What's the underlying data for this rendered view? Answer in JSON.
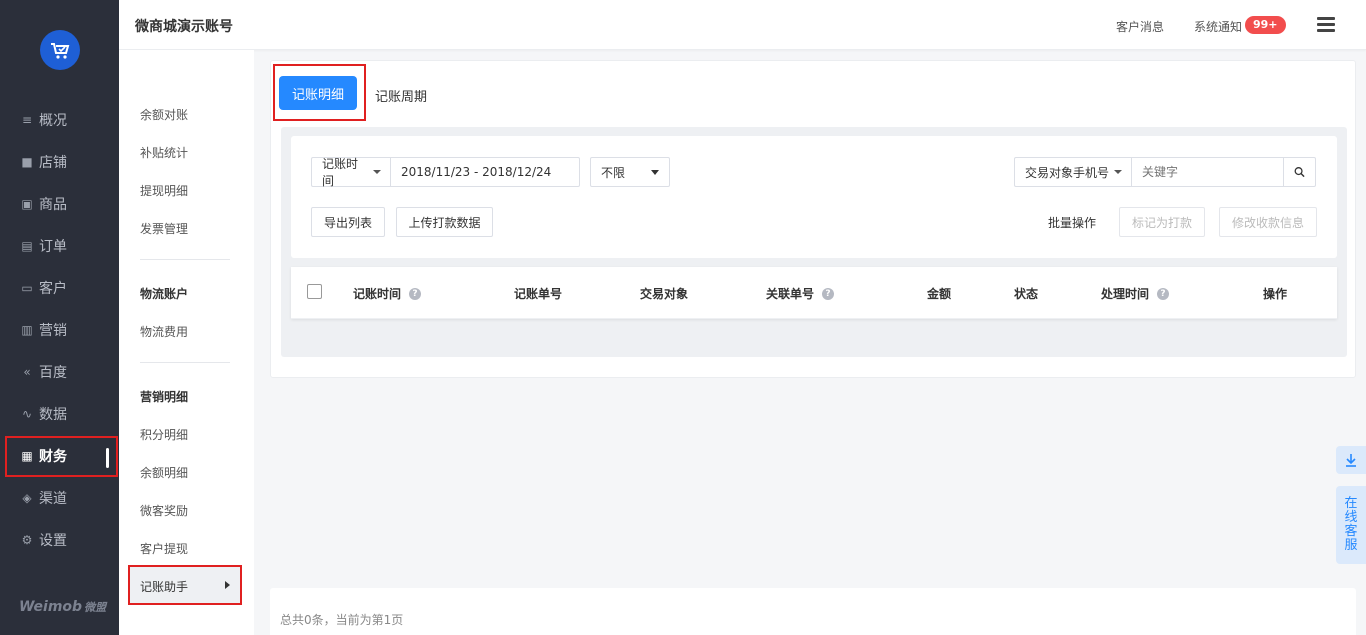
{
  "nav": {
    "items": [
      {
        "label": "概况",
        "icon": "overview-icon"
      },
      {
        "label": "店铺",
        "icon": "store-icon"
      },
      {
        "label": "商品",
        "icon": "goods-icon"
      },
      {
        "label": "订单",
        "icon": "order-icon"
      },
      {
        "label": "客户",
        "icon": "customer-icon"
      },
      {
        "label": "营销",
        "icon": "marketing-icon"
      },
      {
        "label": "百度",
        "icon": "baidu-icon"
      },
      {
        "label": "数据",
        "icon": "data-icon"
      },
      {
        "label": "财务",
        "icon": "finance-icon",
        "active": true
      },
      {
        "label": "渠道",
        "icon": "channel-icon"
      },
      {
        "label": "设置",
        "icon": "settings-icon"
      }
    ],
    "brand": "Weimob",
    "brand_cn": "微盟"
  },
  "header": {
    "title": "微商城演示账号",
    "customer_msg": "客户消息",
    "system_notice": "系统通知",
    "notice_badge": "99+"
  },
  "subnav": {
    "items": {
      "balance_check": "余额对账",
      "subsidy_stats": "补贴统计",
      "withdraw_detail": "提现明细",
      "invoice_mgmt": "发票管理",
      "logistics_head": "物流账户",
      "logistics_fee": "物流费用",
      "marketing_head": "营销明细",
      "points_detail": "积分明细",
      "balance_detail": "余额明细",
      "weike_reward": "微客奖励",
      "customer_withdraw": "客户提现",
      "bookkeeping_assistant": "记账助手"
    }
  },
  "main": {
    "tabs": {
      "active": "记账明细",
      "other": "记账周期"
    },
    "filters": {
      "time_type": "记账时间",
      "date_range": "2018/11/23 - 2018/12/24",
      "status_select": "不限",
      "search_field": "交易对象手机号",
      "search_placeholder": "关键字"
    },
    "actions": {
      "export": "导出列表",
      "upload": "上传打款数据",
      "batch_label": "批量操作",
      "mark_paid": "标记为打款",
      "edit_payee": "修改收款信息"
    },
    "table_headers": {
      "time": "记账时间",
      "number": "记账单号",
      "party": "交易对象",
      "related": "关联单号",
      "amount": "金额",
      "status": "状态",
      "process_time": "处理时间",
      "ops": "操作"
    }
  },
  "footer": {
    "summary": "总共0条，当前为第1页"
  },
  "floating": {
    "online_service": [
      "在",
      "线",
      "客",
      "服"
    ]
  },
  "colors": {
    "primary": "#2589ff",
    "nav_bg": "#2b2f3a",
    "highlight_border": "#e02020",
    "badge": "#f24d4d"
  }
}
